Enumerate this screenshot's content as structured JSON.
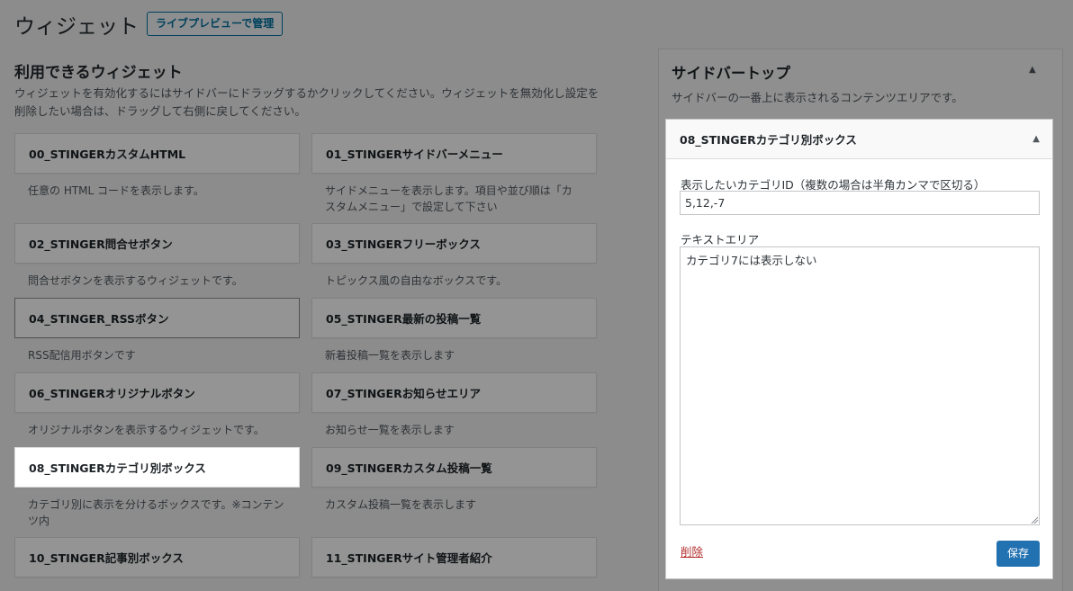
{
  "header": {
    "title": "ウィジェット",
    "manage_button": "ライブプレビューで管理"
  },
  "available": {
    "title": "利用できるウィジェット",
    "description": "ウィジェットを有効化するにはサイドバーにドラッグするかクリックしてください。ウィジェットを無効化し設定を削除したい場合は、ドラッグして右側に戻してください。"
  },
  "widgets": [
    {
      "title": "00_STINGERカスタムHTML",
      "desc": "任意の HTML コードを表示します。"
    },
    {
      "title": "01_STINGERサイドバーメニュー",
      "desc": "サイドメニューを表示します。項目や並び順は「カスタムメニュー」で設定して下さい"
    },
    {
      "title": "02_STINGER問合せボタン",
      "desc": "問合せボタンを表示するウィジェットです。"
    },
    {
      "title": "03_STINGERフリーボックス",
      "desc": "トピックス風の自由なボックスです。"
    },
    {
      "title": "04_STINGER_RSSボタン",
      "desc": "RSS配信用ボタンです"
    },
    {
      "title": "05_STINGER最新の投稿一覧",
      "desc": "新着投稿一覧を表示します"
    },
    {
      "title": "06_STINGERオリジナルボタン",
      "desc": "オリジナルボタンを表示するウィジェットです。"
    },
    {
      "title": "07_STINGERお知らせエリア",
      "desc": "お知らせ一覧を表示します"
    },
    {
      "title": "08_STINGERカテゴリ別ボックス",
      "desc": "カテゴリ別に表示を分けるボックスです。※コンテンツ内"
    },
    {
      "title": "09_STINGERカスタム投稿一覧",
      "desc": "カスタム投稿一覧を表示します"
    },
    {
      "title": "10_STINGER記事別ボックス",
      "desc": ""
    },
    {
      "title": "11_STINGERサイト管理者紹介",
      "desc": ""
    }
  ],
  "sidebar": {
    "title": "サイドバートップ",
    "description": "サイドバーの一番上に表示されるコンテンツエリアです。",
    "toggle_icon": "▲"
  },
  "open_widget": {
    "title": "08_STINGERカテゴリ別ボックス",
    "toggle_icon": "▲",
    "category_label": "表示したいカテゴリID（複数の場合は半角カンマで区切る）",
    "category_value": "5,12,-7",
    "textarea_label": "テキストエリア",
    "textarea_value": "カテゴリ7には表示しない",
    "delete_label": "削除",
    "save_label": "保存"
  },
  "colors": {
    "primary": "#2271b1",
    "delete": "#b32d2e",
    "manage": "#0071a1"
  }
}
